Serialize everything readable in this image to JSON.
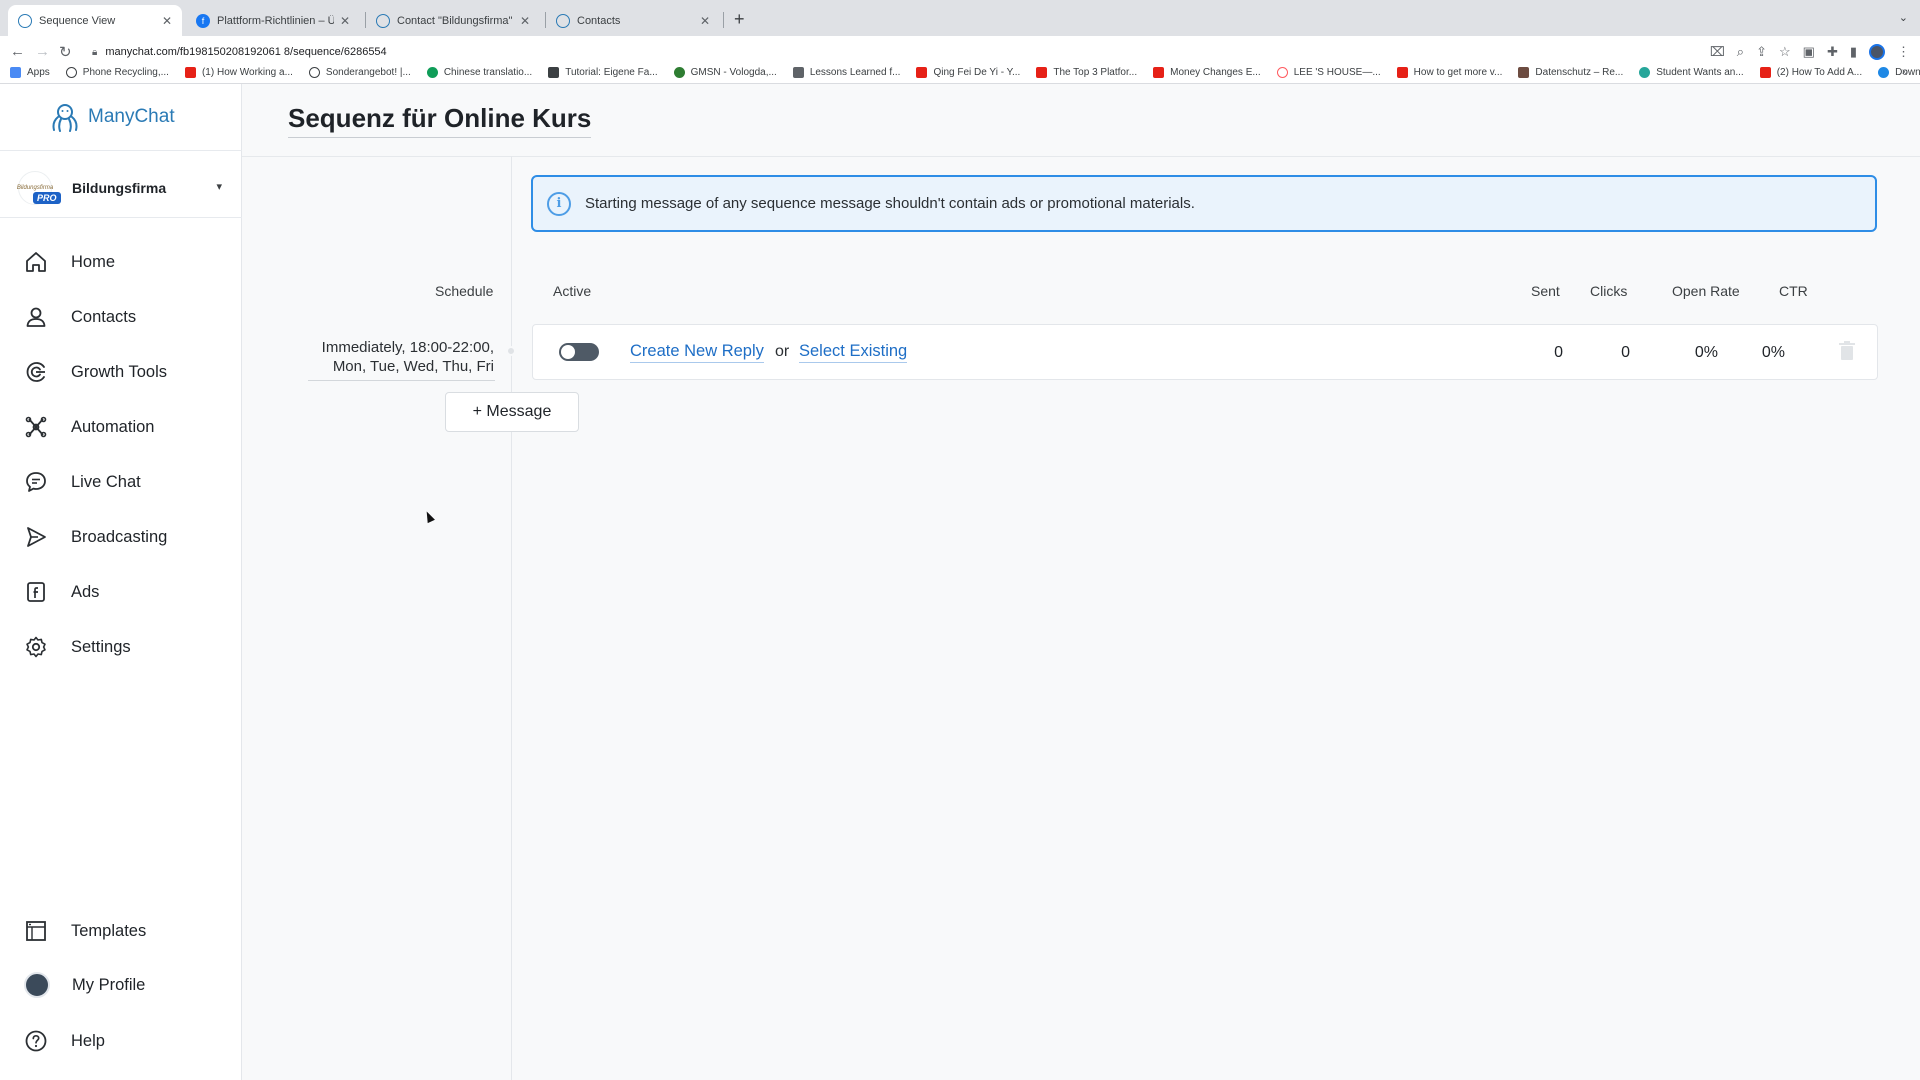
{
  "browser": {
    "tabs": [
      {
        "title": "Sequence View",
        "active": true
      },
      {
        "title": "Plattform-Richtlinien – Übersich",
        "active": false
      },
      {
        "title": "Contact \"Bildungsfirma\" throu",
        "active": false
      },
      {
        "title": "Contacts",
        "active": false
      }
    ],
    "url": "manychat.com/fb198150208192061 8/sequence/6286554",
    "bookmarks": [
      "Apps",
      "Phone Recycling,...",
      "(1) How Working a...",
      "Sonderangebot! |...",
      "Chinese translatio...",
      "Tutorial: Eigene Fa...",
      "GMSN - Vologda,...",
      "Lessons Learned f...",
      "Qing Fei De Yi - Y...",
      "The Top 3 Platfor...",
      "Money Changes E...",
      "LEE 'S HOUSE—...",
      "How to get more v...",
      "Datenschutz – Re...",
      "Student Wants an...",
      "(2) How To Add A...",
      "Download - Cooki..."
    ]
  },
  "app": {
    "brand": "ManyChat",
    "account": {
      "name": "Bildungsfirma",
      "badge": "PRO",
      "logo_text": "Bildungsfirma"
    },
    "nav": {
      "home": "Home",
      "contacts": "Contacts",
      "growth_tools": "Growth Tools",
      "automation": "Automation",
      "live_chat": "Live Chat",
      "broadcasting": "Broadcasting",
      "ads": "Ads",
      "settings": "Settings",
      "templates": "Templates",
      "my_profile": "My Profile",
      "help": "Help"
    }
  },
  "page": {
    "title": "Sequenz für Online Kurs",
    "alert": "Starting message of any sequence message shouldn't contain ads or promotional materials.",
    "headers": {
      "schedule": "Schedule",
      "active": "Active",
      "sent": "Sent",
      "clicks": "Clicks",
      "open_rate": "Open Rate",
      "ctr": "CTR"
    },
    "row": {
      "schedule_line1": "Immediately, 18:00-22:00,",
      "schedule_line2": "Mon, Tue, Wed, Thu, Fri",
      "active": false,
      "create_link": "Create New Reply",
      "or": "or",
      "select_link": "Select Existing",
      "sent": "0",
      "clicks": "0",
      "open_rate": "0%",
      "ctr": "0%"
    },
    "add_message": "+ Message"
  },
  "colors": {
    "brand": "#2a7ab5",
    "link": "#1e6ec6",
    "alert_border": "#2e8de6",
    "alert_bg": "#eaf3fc",
    "pro_badge": "#1d62c6"
  }
}
